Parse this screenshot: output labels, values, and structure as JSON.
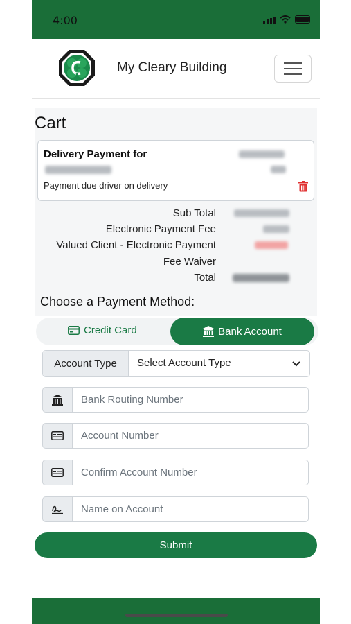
{
  "status_bar": {
    "time": "4:00"
  },
  "header": {
    "title": "My Cleary Building"
  },
  "cart": {
    "title": "Cart",
    "item": {
      "title": "Delivery Payment for",
      "note": "Payment due driver on delivery"
    },
    "summary": {
      "subtotal_label": "Sub Total",
      "fee_label": "Electronic Payment Fee",
      "waiver_label_line1": "Valued Client - Electronic Payment",
      "waiver_label_line2": "Fee Waiver",
      "total_label": "Total"
    }
  },
  "payment": {
    "heading": "Choose a Payment Method:",
    "tabs": {
      "credit_card": "Credit Card",
      "bank_account": "Bank Account",
      "active": "bank_account"
    },
    "account_type": {
      "label": "Account Type",
      "value": "Select Account Type"
    },
    "fields": {
      "routing": "Bank Routing Number",
      "account": "Account Number",
      "confirm": "Confirm Account Number",
      "name": "Name on Account"
    },
    "submit_label": "Submit"
  },
  "colors": {
    "brand_green": "#1a7a45",
    "header_green": "#1a6e38",
    "trash_red": "#e03131"
  }
}
